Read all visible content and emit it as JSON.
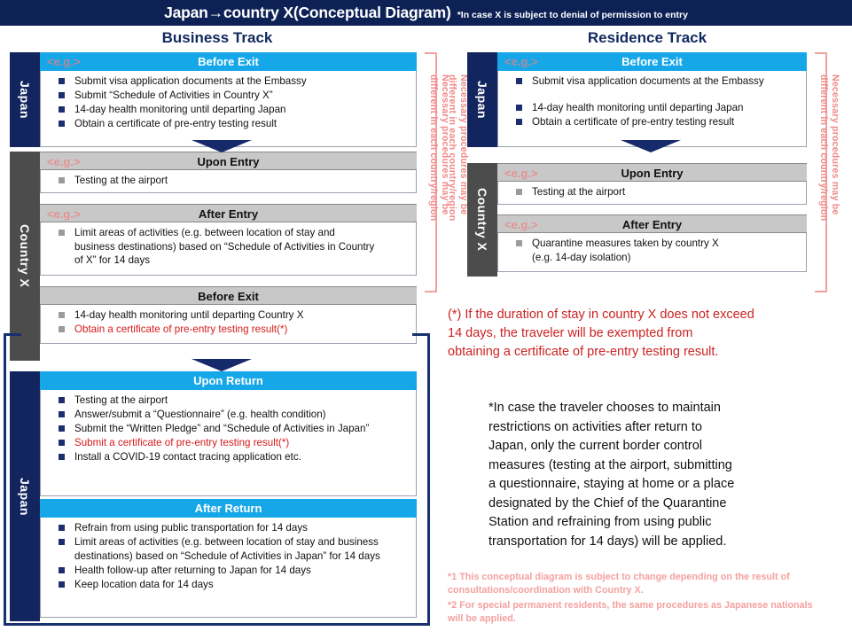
{
  "header": {
    "title": "Japan→country X(Conceptual Diagram)",
    "subtitle": "*In case X is subject to denial of permission to entry"
  },
  "columns": {
    "business_track_title": "Business Track",
    "residence_track_title": "Residence Track"
  },
  "labels": {
    "eg": "<e.g.>",
    "japan": "Japan",
    "country_x": "Country X",
    "bracket_note": "Necessary procedures may be\ndifferent in each country/region"
  },
  "business_track": {
    "japan_before_exit": {
      "bar": "Before Exit",
      "eg": "<e.g.>",
      "items": [
        "Submit visa application documents at the Embassy",
        "Submit “Schedule of Activities in Country X”",
        "14-day health monitoring until departing Japan",
        "Obtain a certificate of pre-entry testing result"
      ]
    },
    "countryx_upon_entry": {
      "bar": "Upon Entry",
      "eg": "<e.g.>",
      "items": [
        "Testing at the airport"
      ]
    },
    "countryx_after_entry": {
      "bar": "After Entry",
      "eg": "<e.g.>",
      "items": [
        "Limit areas of activities (e.g. between location of stay and business destinations) based on “Schedule of Activities in Country of X” for 14 days"
      ]
    },
    "countryx_before_exit": {
      "bar": "Before Exit",
      "items_plain": [
        "14-day health monitoring until departing Country X"
      ],
      "items_red": [
        "Obtain a certificate of pre-entry testing result(*)"
      ]
    },
    "japan_upon_return": {
      "bar": "Upon Return",
      "items": [
        "Testing at the airport",
        "Answer/submit a “Questionnaire” (e.g. health condition)",
        "Submit the “Written Pledge” and “Schedule of Activities in Japan”",
        "Submit a certificate of pre-entry testing result(*)",
        "Install a COVID-19 contact tracing application etc."
      ]
    },
    "japan_after_return": {
      "bar": "After Return",
      "items": [
        "Refrain from using public transportation for 14 days",
        "Limit areas of activities (e.g. between location of stay and business destinations) based on “Schedule of Activities in Japan” for 14 days",
        "Health follow-up after returning to Japan for 14 days",
        "Keep location data for 14 days"
      ]
    }
  },
  "residence_track": {
    "japan_before_exit": {
      "bar": "Before Exit",
      "eg": "<e.g.>",
      "items": [
        "Submit visa application documents at the Embassy",
        "",
        "14-day health monitoring until departing Japan",
        "Obtain a certificate of pre-entry testing result"
      ]
    },
    "countryx_upon_entry": {
      "bar": "Upon Entry",
      "eg": "<e.g.>",
      "items": [
        "Testing at the airport"
      ]
    },
    "countryx_after_entry": {
      "bar": "After Entry",
      "eg": "<e.g.>",
      "items": [
        "Quarantine measures taken by country X\n(e.g. 14-day isolation)"
      ]
    }
  },
  "notes": {
    "asterisk_note": "(*) If the duration of stay in country X  does not exceed\n      14 days,  the traveler will be exempted from\n    obtaining a certificate of pre-entry testing result.",
    "maintain_note": "*In case the traveler chooses to maintain\n  restrictions on activities after return to\n  Japan, only the current border control\n  measures (testing at the airport, submitting\n  a questionnaire, staying at home or a place\n  designated by the Chief of the Quarantine\n  Station and refraining from using public\n  transportation for 14 days)  will be applied.",
    "footnote_1": "*1 This conceptual diagram is subject to change depending on the result of\nconsultations/coordination with Country X.",
    "footnote_2": "*2 For special permanent residents, the same procedures as Japanese nationals\n     will be applied."
  },
  "colors": {
    "header_navy": "#0d2155",
    "bar_blue": "#16a7e8",
    "bar_grey": "#c8c8c8",
    "japan_navy": "#13255e",
    "countryx_grey": "#4c4c4c",
    "red_text": "#cc2222",
    "pink": "#f2a0a0"
  }
}
